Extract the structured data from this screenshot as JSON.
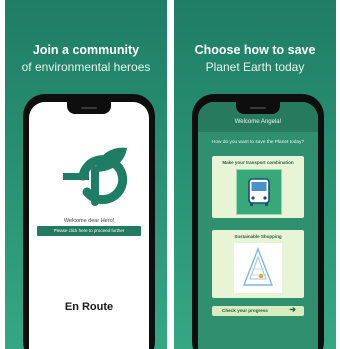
{
  "panel_left": {
    "headline_line1": "Join a community",
    "headline_line2": "of environmental heroes",
    "welcome_text": "Welcome dear Hero!",
    "continue_button": "Please click here to proceed further",
    "app_name": "En Route"
  },
  "panel_right": {
    "headline_line1": "Choose how to save",
    "headline_line2": "Planet Earth today",
    "welcome_text": "Welcome Angela!",
    "question": "How do you want to save the Planet today?",
    "cards": [
      {
        "title": "Make your transport combination",
        "icon": "bus-icon"
      },
      {
        "title": "Sustainable Shopping",
        "icon": "eco-bag-icon"
      }
    ],
    "progress_button": "Check your progress",
    "progress_arrow": "➔"
  },
  "colors": {
    "brand_green": "#1f7d65",
    "dark_green": "#247a5f",
    "card_bg": "#e8f4d6",
    "phone_frame": "#0e0e0e"
  }
}
